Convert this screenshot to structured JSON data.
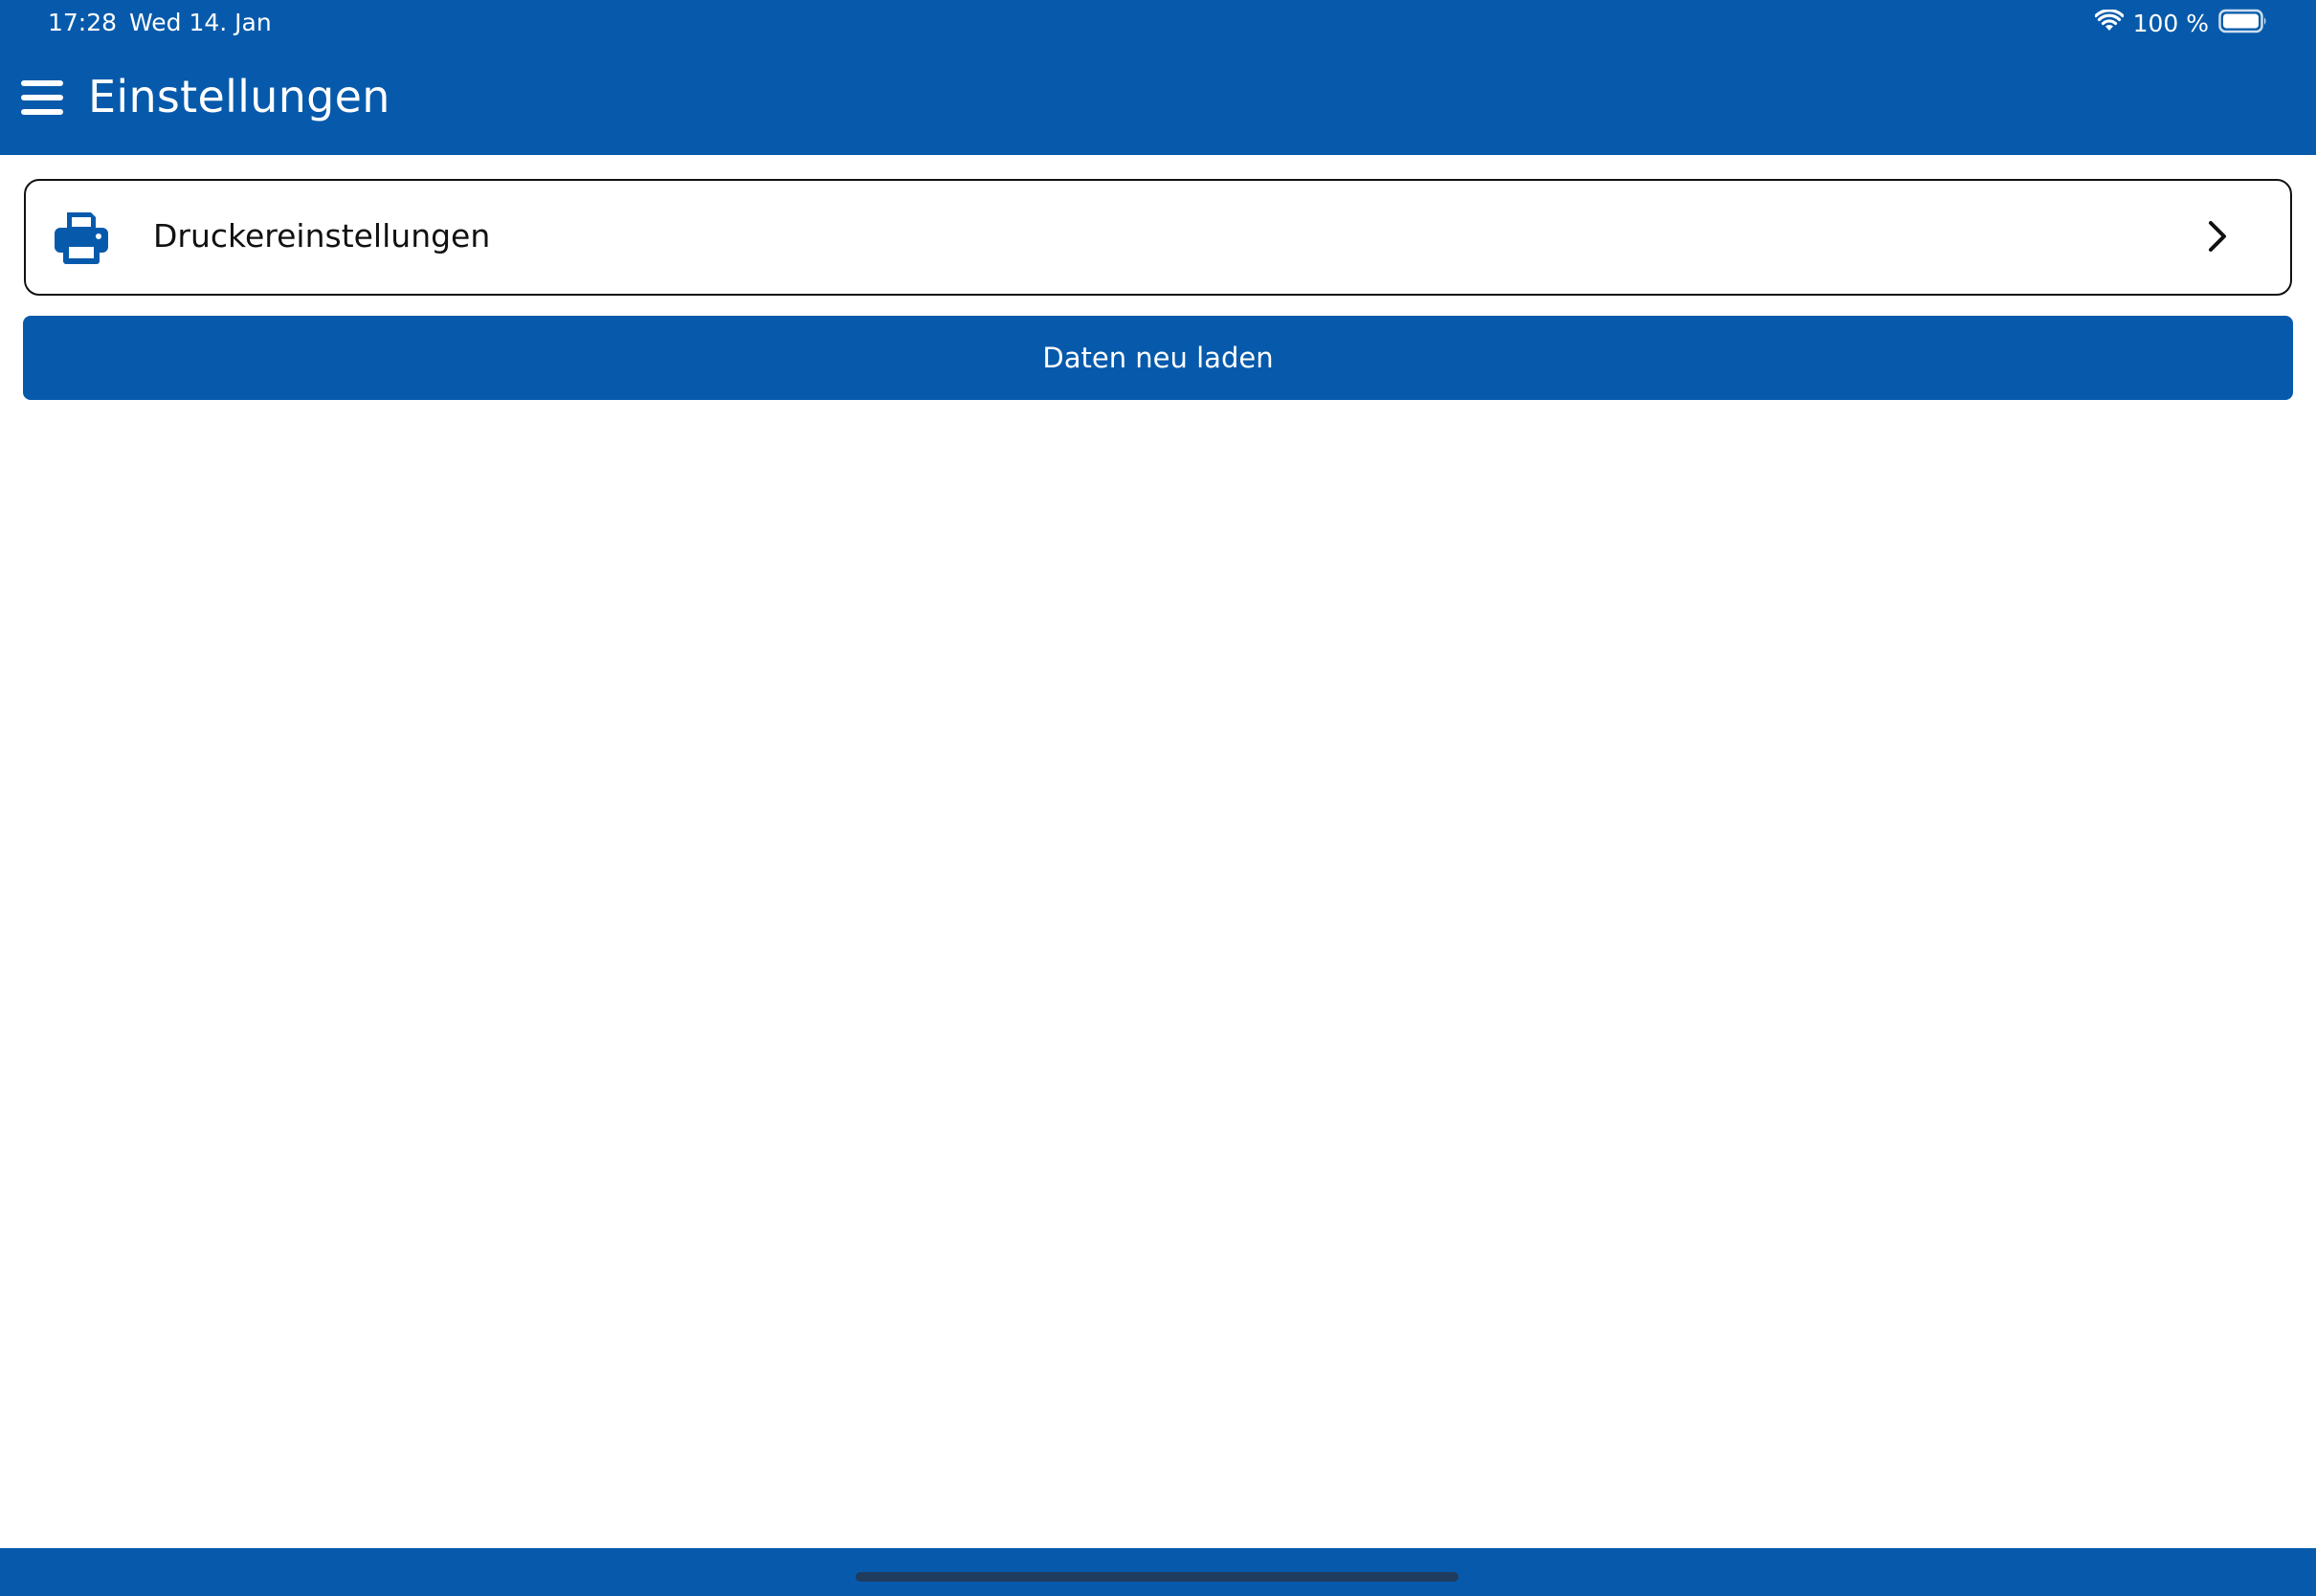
{
  "status_bar": {
    "time": "17:28",
    "date": "Wed 14. Jan",
    "battery_percent": "100 %",
    "battery_level": 1.0,
    "icons": [
      "wifi-icon",
      "battery-icon"
    ]
  },
  "header": {
    "title": "Einstellungen",
    "menu_icon": "hamburger-menu-icon"
  },
  "settings_list": {
    "items": [
      {
        "label": "Druckereinstellungen",
        "icon": "printer-icon",
        "trailing_icon": "chevron-right-icon"
      }
    ]
  },
  "actions": {
    "reload_label": "Daten neu laden"
  },
  "colors": {
    "primary": "#075aab",
    "background": "#ffffff",
    "text": "#111111",
    "on_primary": "#ffffff",
    "home_indicator": "#1f3b5e"
  }
}
